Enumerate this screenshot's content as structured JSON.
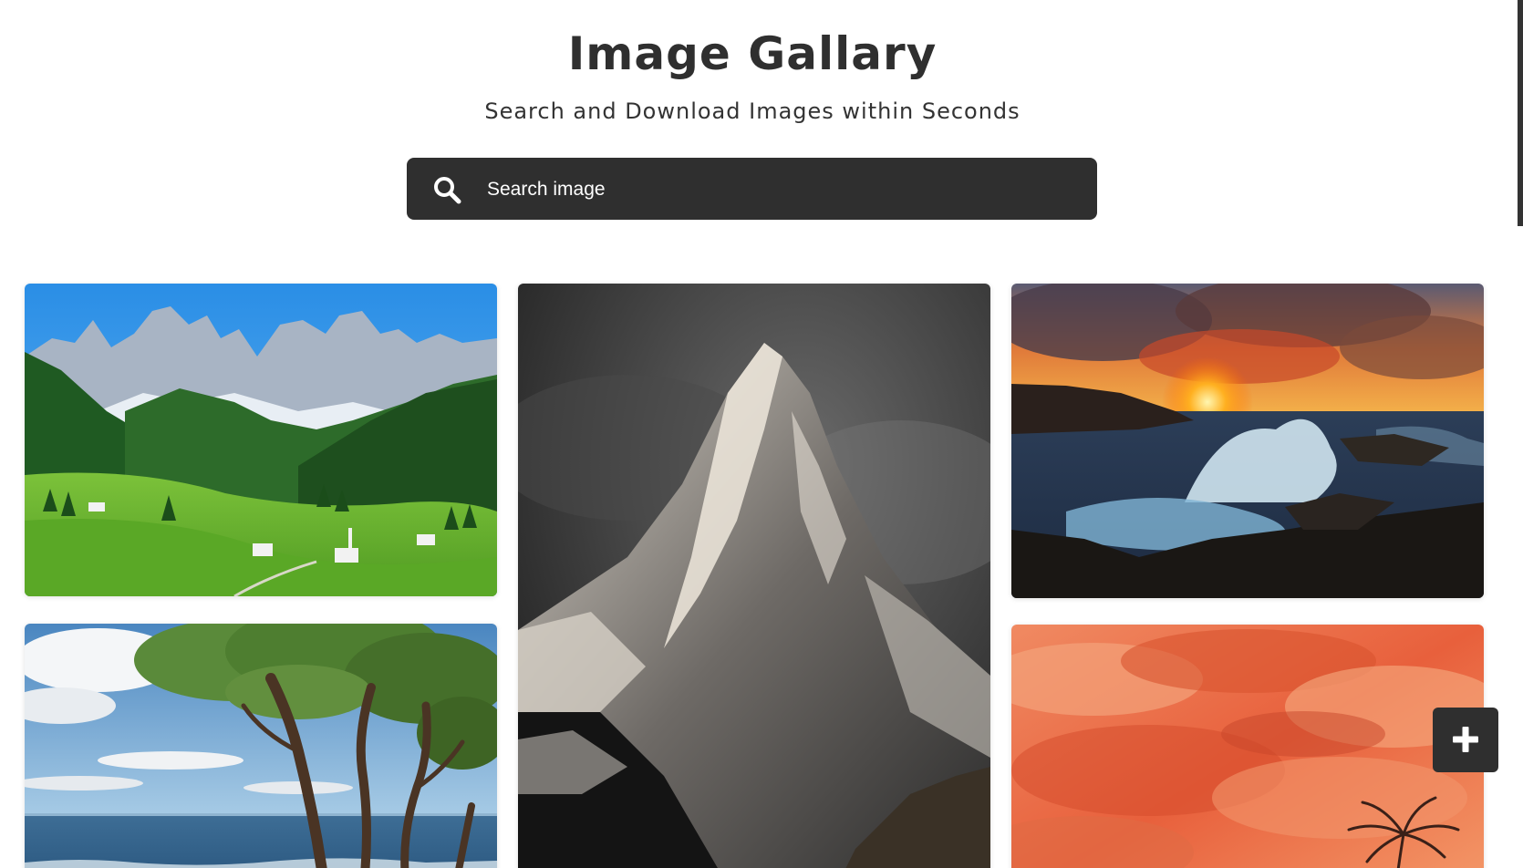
{
  "header": {
    "title": "Image Gallary",
    "subtitle": "Search and Download Images within Seconds"
  },
  "search": {
    "placeholder": "Search image",
    "value": "",
    "icon": "search-icon"
  },
  "gallery": {
    "images": [
      {
        "subject": "alpine-valley-dolomites"
      },
      {
        "subject": "dark-snowy-mountain-peak"
      },
      {
        "subject": "ocean-sunset-crashing-waves"
      },
      {
        "subject": "beach-trees-blue-sky"
      },
      {
        "subject": "orange-cloudy-sunset-sky"
      }
    ]
  },
  "fab": {
    "icon": "plus-icon"
  },
  "colors": {
    "dark": "#2f2f2f",
    "background": "#ffffff",
    "text": "#333333"
  }
}
